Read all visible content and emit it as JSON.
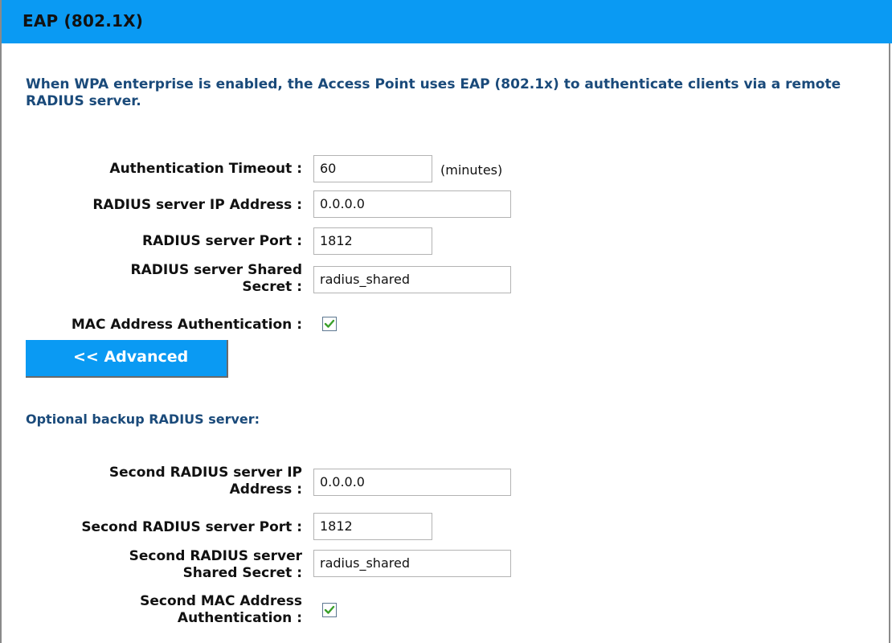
{
  "header": {
    "title": "EAP (802.1X)"
  },
  "intro_text": "When WPA enterprise is enabled, the Access Point uses EAP (802.1x) to authenticate clients via a remote RADIUS server.",
  "primary": {
    "auth_timeout": {
      "label": "Authentication Timeout :",
      "value": "60",
      "suffix": "(minutes)"
    },
    "radius_ip": {
      "label": "RADIUS server IP Address :",
      "value": "0.0.0.0"
    },
    "radius_port": {
      "label": "RADIUS server Port :",
      "value": "1812"
    },
    "radius_secret": {
      "label_line1": "RADIUS server Shared",
      "label_line2": "Secret :",
      "value": "radius_shared"
    },
    "mac_auth": {
      "label": "MAC Address Authentication :",
      "checked": true
    }
  },
  "advanced_button": {
    "label": "<< Advanced"
  },
  "backup": {
    "title": "Optional backup RADIUS server:",
    "radius_ip": {
      "label_line1": "Second RADIUS server IP",
      "label_line2": "Address :",
      "value": "0.0.0.0"
    },
    "radius_port": {
      "label": "Second RADIUS server Port :",
      "value": "1812"
    },
    "radius_secret": {
      "label_line1": "Second RADIUS server",
      "label_line2": "Shared Secret :",
      "value": "radius_shared"
    },
    "mac_auth": {
      "label_line1": "Second MAC Address",
      "label_line2": "Authentication :",
      "checked": true
    }
  },
  "colors": {
    "header_bg": "#0a9af3",
    "heading_text": "#1a4a7a",
    "check_mark": "#3aa02a"
  }
}
